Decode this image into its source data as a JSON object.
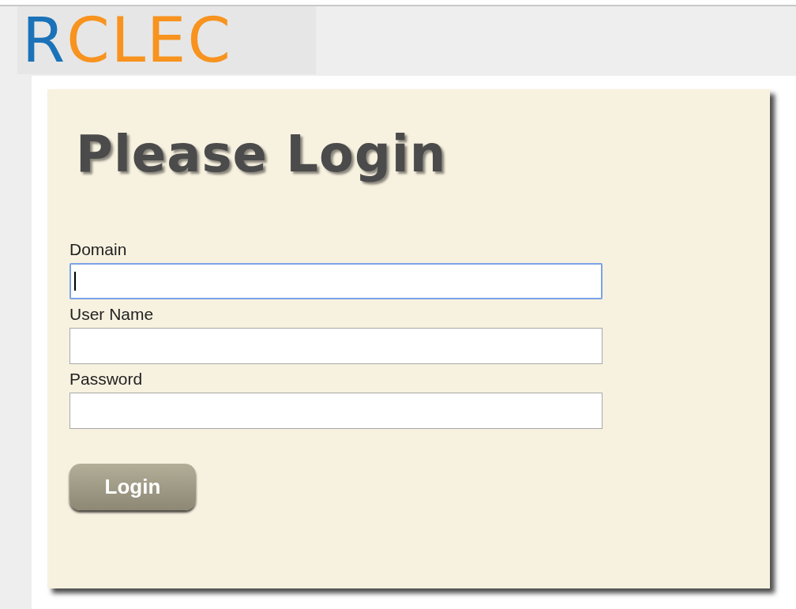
{
  "logo": [
    {
      "text": "R",
      "color": "#1b72b8"
    },
    {
      "text": "CLEC",
      "color": "#f7931e"
    }
  ],
  "title": "Please Login",
  "fields": [
    {
      "label": "Domain",
      "focused": true
    },
    {
      "label": "User Name",
      "focused": false
    },
    {
      "label": "Password",
      "focused": false
    }
  ],
  "button": "Login"
}
